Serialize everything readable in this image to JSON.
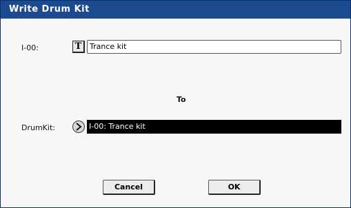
{
  "dialog": {
    "title": "Write Drum Kit"
  },
  "source": {
    "label": "I-00:",
    "text_edit_icon": "T",
    "name_value": "Trance kit"
  },
  "to_label": "To",
  "destination": {
    "label": "DrumKit:",
    "selected_value": "I-00: Trance kit"
  },
  "buttons": {
    "cancel_label": "Cancel",
    "ok_label": "OK"
  },
  "colors": {
    "title_bar": "#1c4a8f",
    "selected_field": "#000000"
  }
}
